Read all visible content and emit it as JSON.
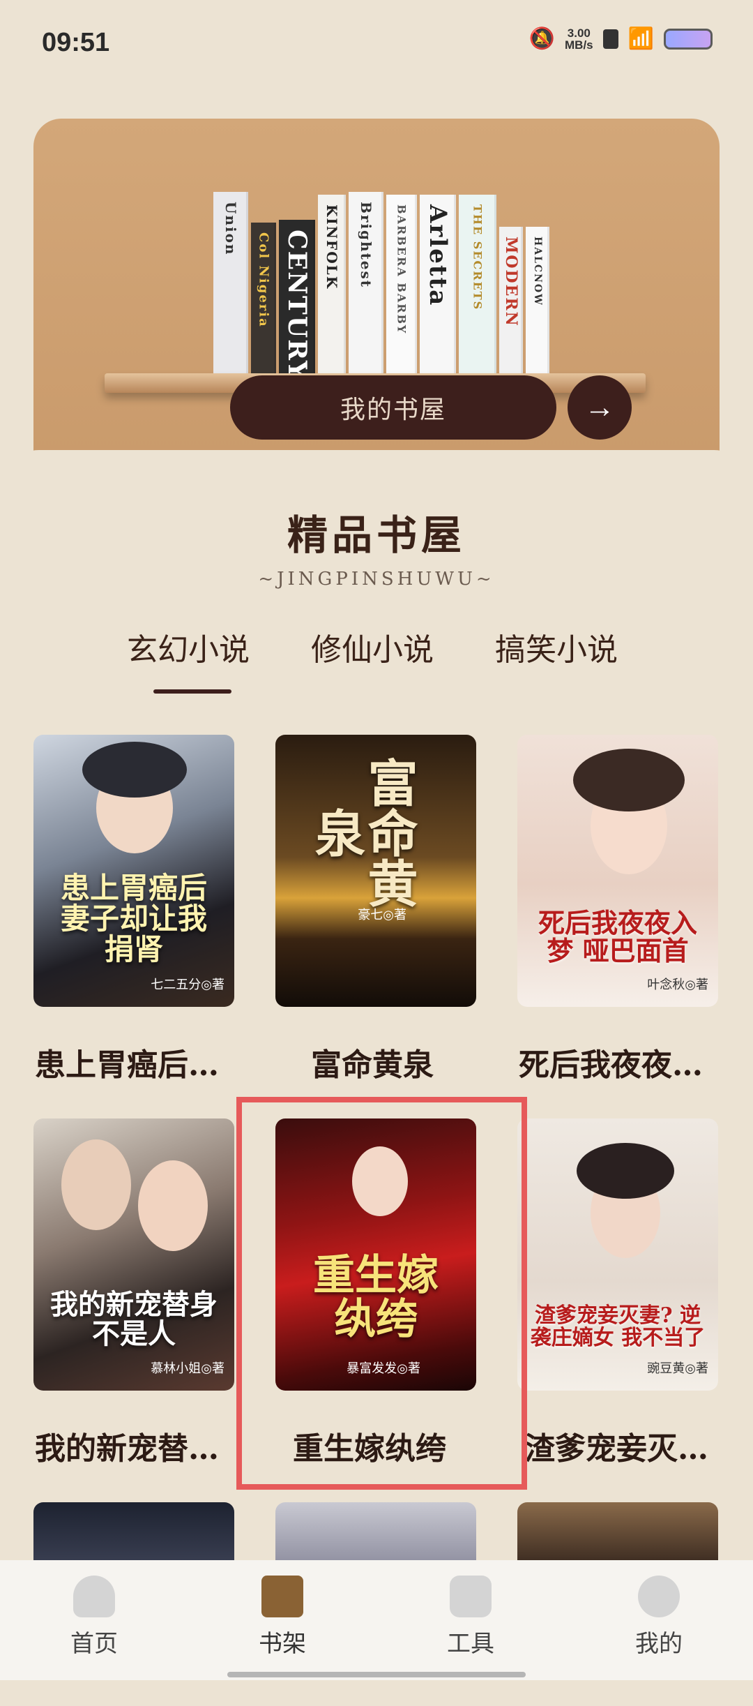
{
  "status": {
    "time": "09:51",
    "speed_value": "3.00",
    "speed_unit": "MB/s"
  },
  "hero": {
    "books": [
      "Union",
      "Col Nigeria",
      "CENTURY",
      "KINFOLK",
      "Brightest",
      "Arletta",
      "BARBERA BARBY",
      "MODERN",
      "HALCNOW"
    ],
    "button_label": "我的书屋",
    "arrow": "→"
  },
  "section": {
    "title": "精品书屋",
    "subtitle": "~JINGPINSHUWU~"
  },
  "tabs": [
    "玄幻小说",
    "修仙小说",
    "搞笑小说"
  ],
  "books": [
    {
      "name": "患上胃癌后…",
      "cover_title": "患上胃癌后 妻子却让我捐肾",
      "author": "七二五分◎著"
    },
    {
      "name": "富命黄泉",
      "cover_title": "富命黄泉",
      "author": "豪七◎著"
    },
    {
      "name": "死后我夜夜…",
      "cover_title": "死后我夜夜入梦 哑巴面首",
      "author": "叶念秋◎著"
    },
    {
      "name": "我的新宠替…",
      "cover_title": "我的新宠替身 不是人",
      "author": "慕林小姐◎著"
    },
    {
      "name": "重生嫁纨绔",
      "cover_title": "重生嫁纨绔",
      "author": "暴富发发◎著"
    },
    {
      "name": "渣爹宠妾灭…",
      "cover_title": "渣爹宠妾灭妻? 逆袭庄嫡女 我不当了",
      "author": "豌豆黄◎著"
    }
  ],
  "nav": [
    {
      "label": "首页",
      "icon": "home-icon"
    },
    {
      "label": "书架",
      "icon": "bookshelf-icon"
    },
    {
      "label": "工具",
      "icon": "toolbag-icon"
    },
    {
      "label": "我的",
      "icon": "profile-icon"
    }
  ]
}
